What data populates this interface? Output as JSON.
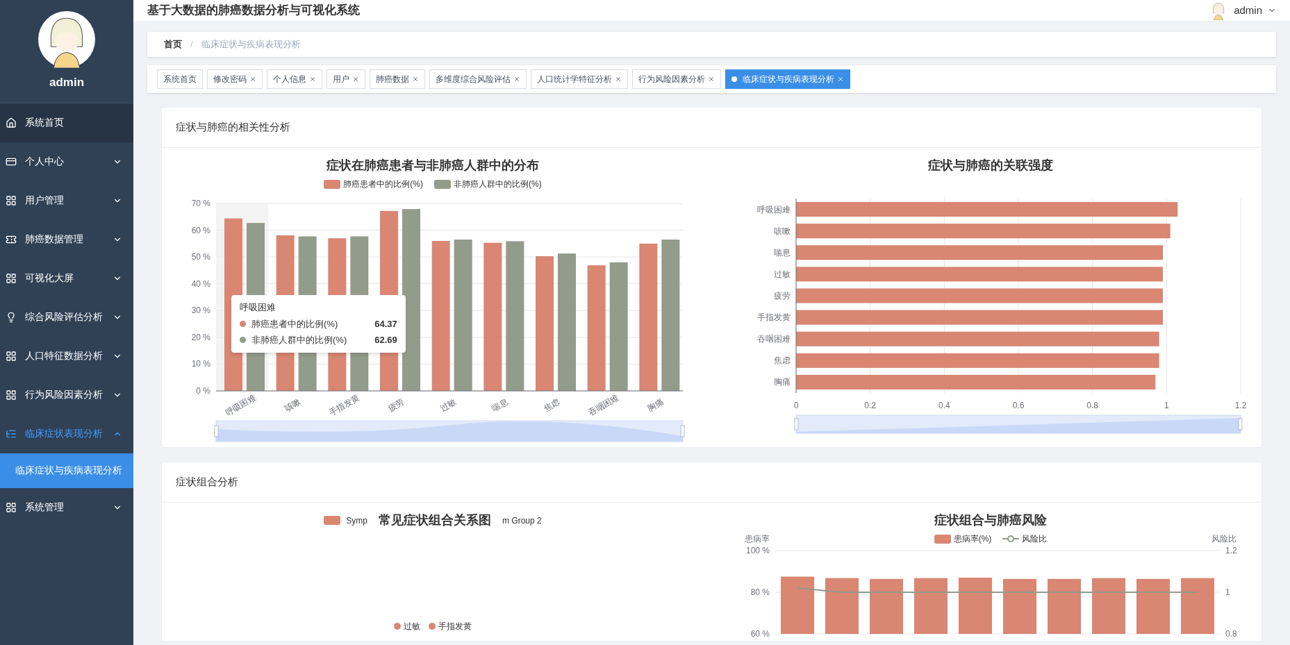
{
  "sidebar": {
    "user": "admin",
    "items": [
      {
        "label": "系统首页",
        "selected": false,
        "hovered": true
      },
      {
        "label": "个人中心",
        "selected": false,
        "hovered": false,
        "expanded": false
      },
      {
        "label": "用户管理",
        "selected": false,
        "hovered": false,
        "expanded": false
      },
      {
        "label": "肺癌数据管理",
        "selected": false,
        "hovered": false,
        "expanded": false
      },
      {
        "label": "可视化大屏",
        "selected": false,
        "hovered": false,
        "expanded": false
      },
      {
        "label": "综合风险评估分析",
        "selected": false,
        "hovered": false,
        "expanded": false
      },
      {
        "label": "人口特征数据分析",
        "selected": false,
        "hovered": false,
        "expanded": false
      },
      {
        "label": "行为风险因素分析",
        "selected": false,
        "hovered": false,
        "expanded": false
      },
      {
        "label": "临床症状表现分析",
        "selected": true,
        "hovered": false,
        "expanded": true,
        "children": [
          {
            "label": "临床症状与疾病表现分析",
            "selected": true
          }
        ]
      },
      {
        "label": "系统管理",
        "selected": false,
        "hovered": false,
        "expanded": false
      }
    ]
  },
  "header": {
    "title": "基于大数据的肺癌数据分析与可视化系统",
    "user": "admin"
  },
  "breadcrumb": {
    "items": [
      "首页",
      "临床症状与疾病表现分析"
    ],
    "separator": "/"
  },
  "tabs": [
    {
      "label": "系统首页",
      "closable": false,
      "selected": false
    },
    {
      "label": "修改密码",
      "closable": true,
      "selected": false
    },
    {
      "label": "个人信息",
      "closable": true,
      "selected": false
    },
    {
      "label": "用户",
      "closable": true,
      "selected": false
    },
    {
      "label": "肺癌数据",
      "closable": true,
      "selected": false
    },
    {
      "label": "多维度综合风险评估",
      "closable": true,
      "selected": false
    },
    {
      "label": "人口统计学特征分析",
      "closable": true,
      "selected": false
    },
    {
      "label": "行为风险因素分析",
      "closable": true,
      "selected": false
    },
    {
      "label": "临床症状与疾病表现分析",
      "closable": true,
      "selected": true
    }
  ],
  "section_1": {
    "title": "症状与肺癌的相关性分析",
    "distribution_chart": {
      "chart_data": {
        "type": "bar",
        "title": "症状在肺癌患者与非肺癌人群中的分布",
        "categories": [
          "呼吸困难",
          "咳嗽",
          "手指发黄",
          "疲劳",
          "过敏",
          "喘息",
          "焦虑",
          "吞咽困难",
          "胸痛"
        ],
        "series": [
          {
            "name": "肺癌患者中的比例(%)",
            "color": "#d98673",
            "values": [
              64.4,
              58.1,
              57.0,
              67.2,
              56.0,
              55.3,
              50.3,
              46.9,
              55.0
            ]
          },
          {
            "name": "非肺癌人群中的比例(%)",
            "color": "#939b8a",
            "values": [
              62.7,
              57.7,
              57.7,
              67.9,
              56.5,
              55.9,
              51.3,
              48.0,
              56.5
            ]
          }
        ],
        "ylim": [
          0,
          70
        ],
        "yticks": [
          {
            "value": 0,
            "label": "0 %"
          },
          {
            "value": 10,
            "label": "10 %"
          },
          {
            "value": 20,
            "label": "20 %"
          },
          {
            "value": 30,
            "label": "30 %"
          },
          {
            "value": 40,
            "label": "40 %"
          },
          {
            "value": 50,
            "label": "50 %"
          },
          {
            "value": 60,
            "label": "60 %"
          },
          {
            "value": 70,
            "label": "70 %"
          }
        ],
        "grid": true
      },
      "tooltip": {
        "title": "呼吸困难",
        "rows": [
          {
            "name": "肺癌患者中的比例(%)",
            "value": "64.37",
            "color": "#d98673"
          },
          {
            "name": "非肺癌人群中的比例(%)",
            "value": "62.69",
            "color": "#939b8a"
          }
        ]
      }
    },
    "strength_chart": {
      "chart_data": {
        "type": "bar",
        "orientation": "horizontal",
        "title": "症状与肺癌的关联强度",
        "categories": [
          "呼吸困难",
          "咳嗽",
          "喘息",
          "过敏",
          "疲劳",
          "手指发黄",
          "吞咽困难",
          "焦虑",
          "胸痛"
        ],
        "series": [
          {
            "color": "#d98673",
            "values": [
              1.03,
              1.01,
              0.99,
              0.99,
              0.99,
              0.99,
              0.98,
              0.98,
              0.97
            ]
          }
        ],
        "xlim": [
          0,
          1.2
        ],
        "xticks": [
          0,
          0.2,
          0.4,
          0.6,
          0.8,
          1,
          1.2
        ],
        "grid": true
      }
    }
  },
  "section_2": {
    "title": "症状组合分析",
    "network_chart": {
      "title": "常见症状组合关系图",
      "legend": [
        "Symp",
        "m Group 2"
      ],
      "nodes": [
        "过敏",
        "手指发黄"
      ]
    },
    "risk_chart": {
      "chart_data": {
        "type": "bar",
        "title": "症状组合与肺癌风险",
        "ylabel": "患病率",
        "series": [
          {
            "name": "患病率(%)",
            "color": "#d98673",
            "values": [
              87.5,
              86.8,
              86.4,
              86.8,
              87.0,
              86.4,
              86.4,
              86.8,
              86.4,
              86.8
            ]
          },
          {
            "name": "风险比",
            "color": "#939b8a",
            "type": "line",
            "axis": "y2",
            "values": [
              1.02,
              1.0,
              1.0,
              1.0,
              1.0,
              1.0,
              1.0,
              1.0,
              1.0,
              1.0
            ]
          }
        ],
        "ylim": [
          60,
          100
        ],
        "yticks": [
          {
            "value": 60,
            "label": "60 %"
          },
          {
            "value": 80,
            "label": "80 %"
          },
          {
            "value": 100,
            "label": "100 %"
          }
        ],
        "y2label": "风险比",
        "y2lim": [
          0.8,
          1.2
        ],
        "y2ticks": [
          0.8,
          1,
          1.2
        ],
        "grid": true
      }
    }
  }
}
